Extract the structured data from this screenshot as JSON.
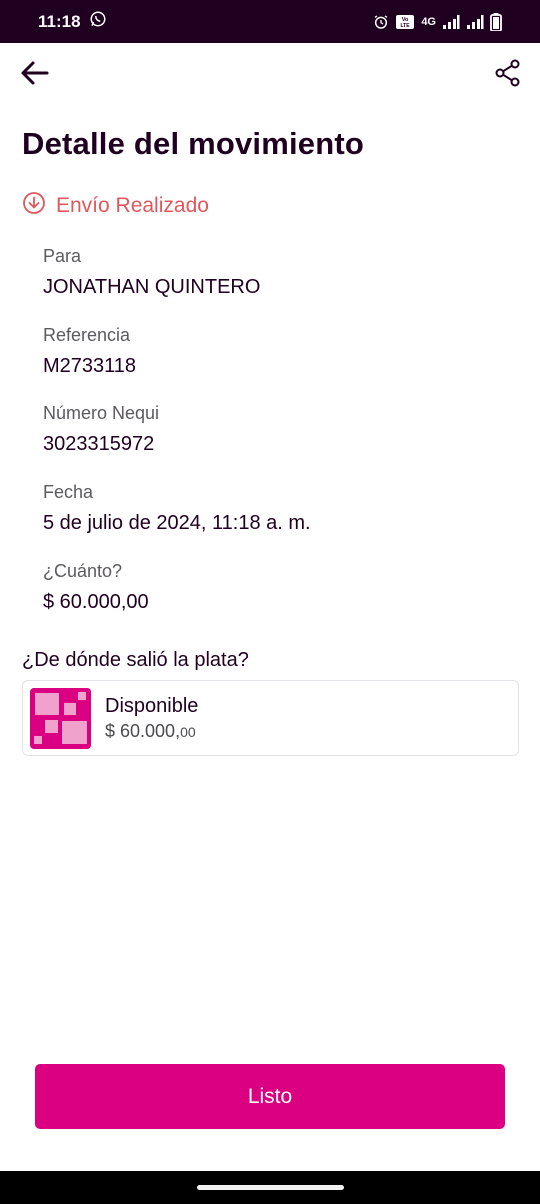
{
  "status_bar": {
    "time": "11:18",
    "network": "4G",
    "volte": "Vo LTE"
  },
  "header": {
    "title": "Detalle del movimiento"
  },
  "movement": {
    "status": "Envío Realizado",
    "fields": [
      {
        "label": "Para",
        "value": "JONATHAN QUINTERO"
      },
      {
        "label": "Referencia",
        "value": "M2733118"
      },
      {
        "label": "Número Nequi",
        "value": "3023315972"
      },
      {
        "label": "Fecha",
        "value": "5 de julio de 2024, 11:18 a. m."
      },
      {
        "label": "¿Cuánto?",
        "value": "$ 60.000,00"
      }
    ]
  },
  "source": {
    "title": "¿De dónde salió la plata?",
    "name": "Disponible",
    "amount_main": "$ 60.000,",
    "amount_cents": "00"
  },
  "actions": {
    "done_label": "Listo"
  },
  "colors": {
    "brand": "#da0081",
    "dark": "#200020",
    "status_sent": "#e0585c"
  }
}
